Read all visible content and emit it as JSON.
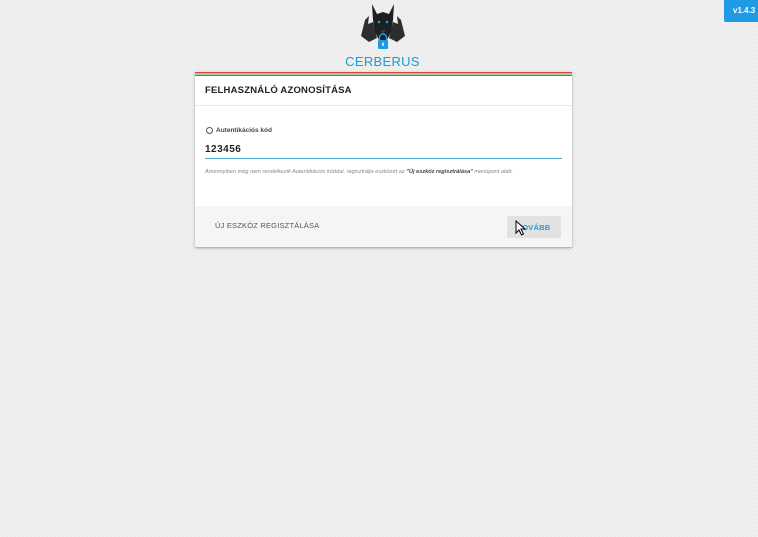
{
  "app": {
    "version": "v1.4.3",
    "logo_text": "CERBERUS",
    "accent_color": "#1e9be4"
  },
  "card": {
    "title": "FELHASZNÁLÓ AZONOSÍTÁSA",
    "field": {
      "label": "Autentikációs kód",
      "value": "123456"
    },
    "help": {
      "prefix": "Amennyiben még nem rendelkezik Autentikációs kóddal, regisztrálja eszközét az ",
      "highlight": "\"Új eszköz regisztrálása\"",
      "suffix": " menüpont alatt."
    },
    "footer": {
      "register_label": "ÚJ ESZKÖZ REGISZTÁLÁSA",
      "next_label": "TOVÁBB"
    }
  },
  "icons": {
    "logo": "cerberus-dog-lock-icon",
    "radio": "radio-circle-icon",
    "cursor": "mouse-pointer-icon"
  }
}
